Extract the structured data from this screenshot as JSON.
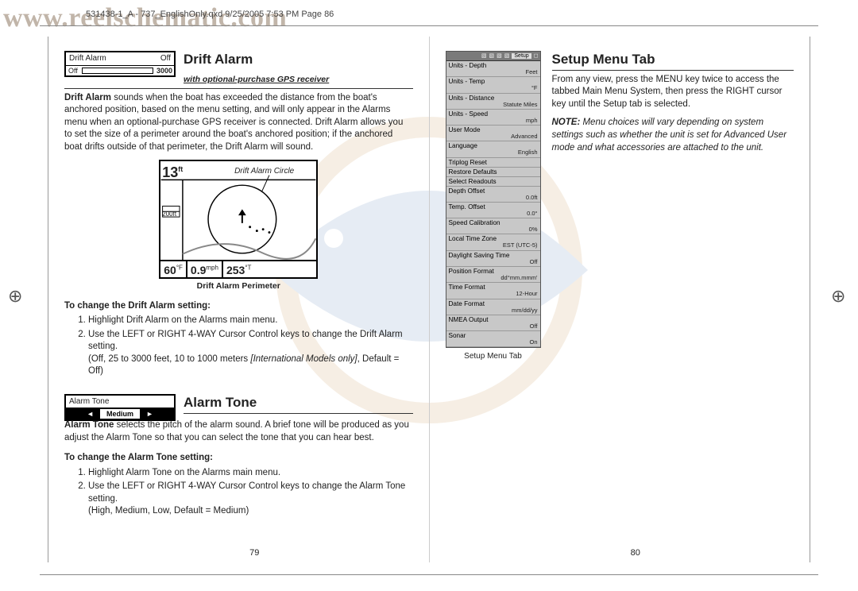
{
  "watermark": "www.reelschematic.com",
  "printHeader": "531438-1_A - 737_EnglishOnly.qxd  9/25/2005  7:53 PM  Page 86",
  "left": {
    "driftAlarmUI": {
      "title": "Drift Alarm",
      "state": "Off",
      "offLabel": "Off",
      "rangeMax": "3000"
    },
    "driftAlarm": {
      "title": "Drift Alarm",
      "subtitle": "with optional-purchase GPS receiver",
      "lead": "Drift Alarm",
      "body": " sounds when the boat has exceeded the distance from the boat's anchored position, based on the menu setting, and will only appear in the Alarms menu when an optional-purchase GPS receiver is connected. Drift Alarm allows you to set the size of a perimeter around the boat's anchored position; if the anchored boat drifts outside of that perimeter, the Drift Alarm will sound.",
      "diagram": {
        "depth": "13",
        "depthUnit": "ft",
        "labelCircle": "Drift Alarm Circle",
        "sideLabel": "200ft",
        "readouts": {
          "temp": "60",
          "tempUnit": "°F",
          "speed": "0.9",
          "speedUnit": "mph",
          "course": "253",
          "courseUnit": "°T"
        },
        "caption": "Drift Alarm Perimeter"
      },
      "changeHead": "To change the Drift Alarm setting:",
      "steps": [
        "Highlight Drift Alarm on the Alarms main menu.",
        "Use the LEFT or RIGHT 4-WAY Cursor Control keys to change the Drift Alarm setting."
      ],
      "stepsNote": "(Off, 25 to 3000 feet, 10 to 1000 meters ",
      "stepsNoteItalic": "[International Models only]",
      "stepsNoteTail": ", Default = Off)"
    },
    "alarmToneUI": {
      "title": "Alarm  Tone",
      "value": "Medium"
    },
    "alarmTone": {
      "title": "Alarm Tone",
      "lead": "Alarm Tone",
      "body": " selects the pitch of the alarm sound. A brief tone will be produced as you adjust the Alarm Tone so that you can select the tone that you can hear best.",
      "changeHead": "To change the Alarm Tone setting:",
      "steps": [
        "Highlight Alarm Tone on the Alarms main menu.",
        "Use the LEFT or RIGHT 4-WAY Cursor Control keys to change the Alarm Tone setting."
      ],
      "stepsNote": "(High, Medium, Low, Default = Medium)"
    },
    "pageNum": "79"
  },
  "right": {
    "title": "Setup Menu Tab",
    "intro": "From any view, press the MENU key twice to access the tabbed Main Menu System, then press the RIGHT cursor key until the Setup tab is selected.",
    "noteLead": "NOTE:",
    "noteBody": " Menu choices will vary depending on system settings such as whether the unit is set for Advanced User mode and what accessories are attached to the unit.",
    "menu": {
      "tabsLabel": "Setup",
      "rows": [
        {
          "k": "Units - Depth",
          "v": "Feet"
        },
        {
          "k": "Units - Temp",
          "v": "°F"
        },
        {
          "k": "Units - Distance",
          "v": "Statute Miles"
        },
        {
          "k": "Units - Speed",
          "v": "mph"
        },
        {
          "k": "User Mode",
          "v": "Advanced"
        },
        {
          "k": "Language",
          "v": "English"
        },
        {
          "k": "Triplog Reset",
          "v": ""
        },
        {
          "k": "Restore Defaults",
          "v": ""
        },
        {
          "k": "Select Readouts",
          "v": ""
        },
        {
          "k": "Depth Offset",
          "v": "0.0ft"
        },
        {
          "k": "Temp. Offset",
          "v": "0.0°"
        },
        {
          "k": "Speed Calibration",
          "v": "0%"
        },
        {
          "k": "Local Time Zone",
          "v": "EST (UTC-5)"
        },
        {
          "k": "Daylight Saving Time",
          "v": "Off"
        },
        {
          "k": "Position Format",
          "v": "dd°mm.mmm'"
        },
        {
          "k": "Time Format",
          "v": "12-Hour"
        },
        {
          "k": "Date Format",
          "v": "mm/dd/yy"
        },
        {
          "k": "NMEA Output",
          "v": "Off"
        },
        {
          "k": "Sonar",
          "v": "On"
        }
      ],
      "caption": "Setup Menu Tab"
    },
    "pageNum": "80"
  }
}
